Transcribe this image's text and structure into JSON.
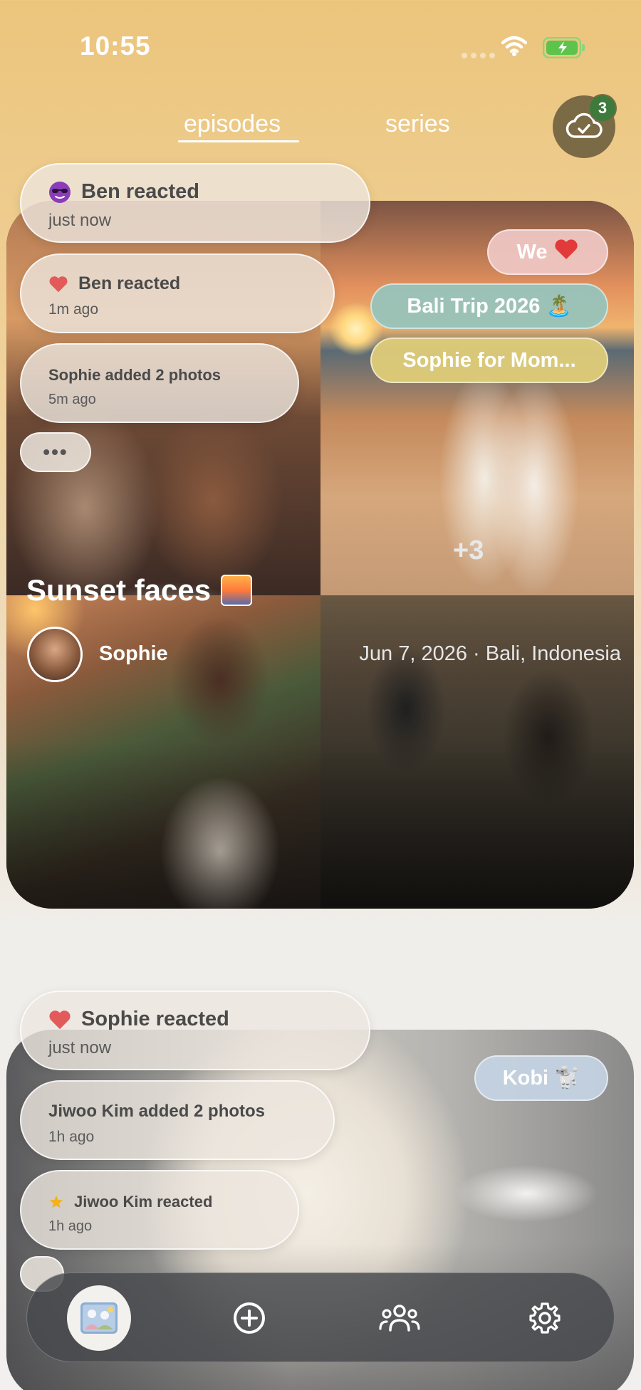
{
  "status_bar": {
    "time": "10:55"
  },
  "tabs": {
    "episodes": "episodes",
    "series": "series"
  },
  "sync": {
    "badge_count": "3",
    "icon": "cloud-check-icon"
  },
  "episode1": {
    "tags": {
      "we": "We",
      "bali": "Bali Trip 2026 🏝️",
      "mom": "Sophie for Mom..."
    },
    "notifications": [
      {
        "icon": "sunglasses-emoji-icon",
        "text": "Ben reacted",
        "time": "just now"
      },
      {
        "icon": "heart-icon",
        "text": "Ben reacted",
        "time": "1m ago"
      },
      {
        "text": "Sophie added 2 photos",
        "time": "5m ago"
      }
    ],
    "more": "•••",
    "more_photos": "+3",
    "title": "Sunset faces",
    "owner": "Sophie",
    "meta": "Jun 7, 2026 · Bali, Indonesia"
  },
  "episode2": {
    "tags": {
      "kobi": "Kobi 🐩"
    },
    "notifications": [
      {
        "icon": "heart-icon",
        "text": "Sophie reacted",
        "time": "just now"
      },
      {
        "text": "Jiwoo Kim added 2 photos",
        "time": "1h ago"
      },
      {
        "icon": "star-icon",
        "text": "Jiwoo Kim reacted",
        "time": "1h ago"
      }
    ]
  },
  "nav": {
    "items": [
      {
        "icon": "photos-icon",
        "active": true
      },
      {
        "icon": "add-circle-icon"
      },
      {
        "icon": "people-icon"
      },
      {
        "icon": "gear-icon"
      }
    ]
  },
  "colors": {
    "accent": "#3e7a3c",
    "heart": "#e23a3a"
  }
}
